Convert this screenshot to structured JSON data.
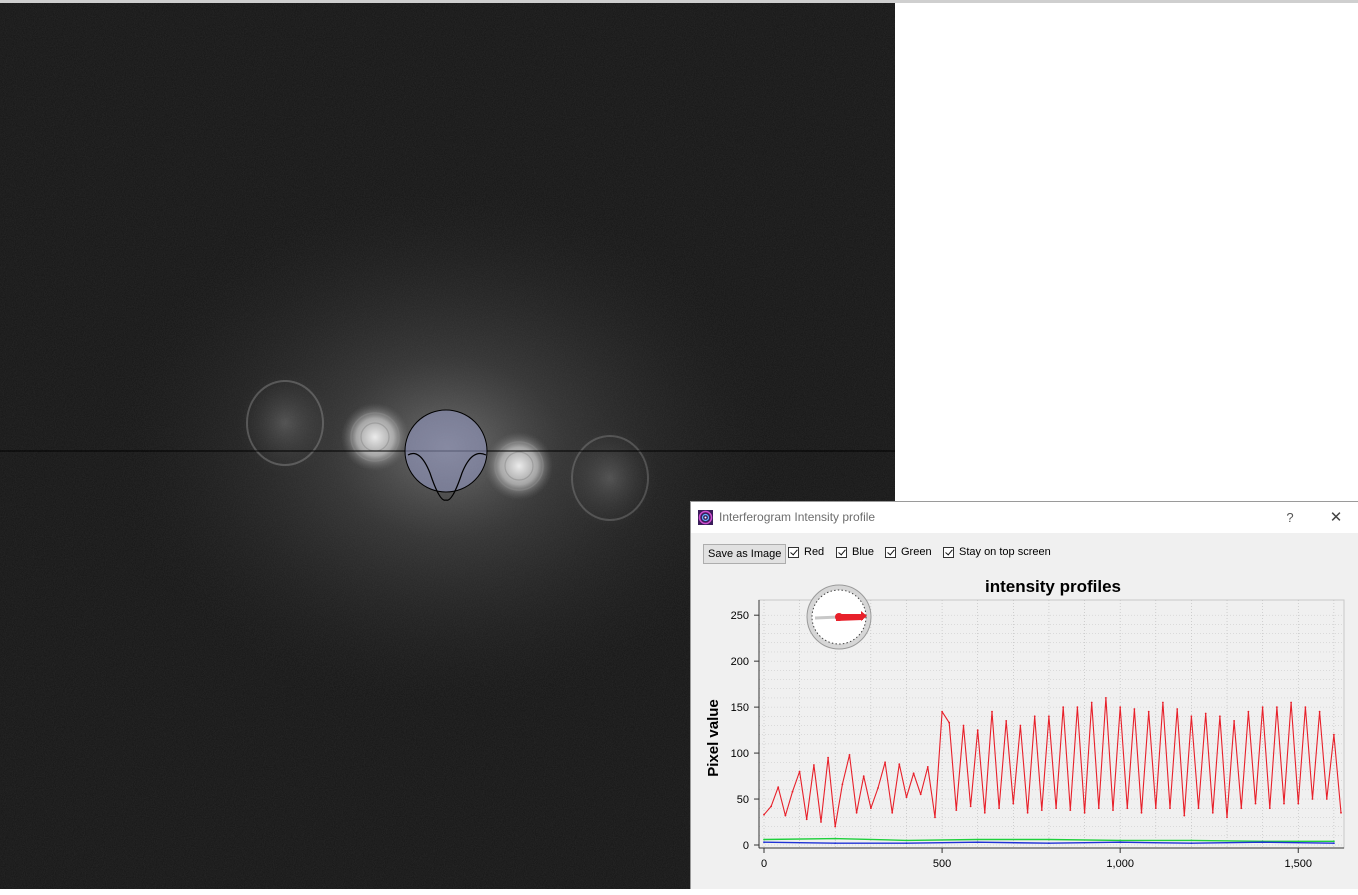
{
  "dialog": {
    "title": "Interferogram Intensity profile",
    "help_label": "?",
    "close_label": "✕",
    "toolbar": {
      "save_label": "Save as Image",
      "checkboxes": [
        {
          "label": "Red",
          "checked": true
        },
        {
          "label": "Blue",
          "checked": true
        },
        {
          "label": "Green",
          "checked": true
        },
        {
          "label": "Stay on top screen",
          "checked": true
        }
      ]
    }
  },
  "colors": {
    "red_series": "#e8202a",
    "blue_series": "#1f33d6",
    "green_series": "#1fcf3c",
    "fft_background": "#202020"
  },
  "chart_data": {
    "type": "line",
    "title": "intensity profiles",
    "xlabel": "",
    "ylabel": "Pixel value",
    "xlim": [
      0,
      1620
    ],
    "ylim": [
      0,
      260
    ],
    "x_ticks": [
      "0",
      "500",
      "1,000",
      "1,500"
    ],
    "y_ticks": [
      "0",
      "50",
      "100",
      "150",
      "200",
      "250"
    ],
    "grid": true,
    "series": [
      {
        "color": "red",
        "x": [
          0,
          20,
          40,
          60,
          80,
          100,
          120,
          140,
          160,
          180,
          200,
          220,
          240,
          260,
          280,
          300,
          320,
          340,
          360,
          380,
          400,
          420,
          440,
          460,
          480,
          500,
          520,
          540,
          560,
          580,
          600,
          620,
          640,
          660,
          680,
          700,
          720,
          740,
          760,
          780,
          800,
          820,
          840,
          860,
          880,
          900,
          920,
          940,
          960,
          980,
          1000,
          1020,
          1040,
          1060,
          1080,
          1100,
          1120,
          1140,
          1160,
          1180,
          1200,
          1220,
          1240,
          1260,
          1280,
          1300,
          1320,
          1340,
          1360,
          1380,
          1400,
          1420,
          1440,
          1460,
          1480,
          1500,
          1520,
          1540,
          1560,
          1580,
          1600,
          1620
        ],
        "values": [
          33,
          42,
          63,
          32,
          58,
          80,
          28,
          87,
          25,
          95,
          20,
          66,
          98,
          35,
          75,
          40,
          62,
          90,
          35,
          88,
          52,
          78,
          55,
          85,
          30,
          145,
          133,
          38,
          130,
          42,
          125,
          35,
          145,
          40,
          135,
          45,
          130,
          35,
          140,
          38,
          140,
          40,
          150,
          38,
          150,
          35,
          155,
          40,
          160,
          38,
          150,
          40,
          148,
          35,
          145,
          40,
          155,
          40,
          148,
          32,
          140,
          40,
          143,
          35,
          140,
          30,
          135,
          40,
          145,
          45,
          150,
          40,
          150,
          45,
          155,
          45,
          150,
          50,
          145,
          50,
          120,
          35
        ]
      },
      {
        "color": "blue",
        "x": [
          0,
          200,
          400,
          600,
          800,
          1000,
          1200,
          1400,
          1600
        ],
        "values": [
          3,
          2,
          2,
          3,
          2,
          3,
          2,
          3,
          2
        ]
      },
      {
        "color": "green",
        "x": [
          0,
          200,
          400,
          600,
          800,
          1000,
          1200,
          1400,
          1600
        ],
        "values": [
          6,
          7,
          5,
          6,
          6,
          5,
          5,
          4,
          4
        ]
      }
    ]
  }
}
